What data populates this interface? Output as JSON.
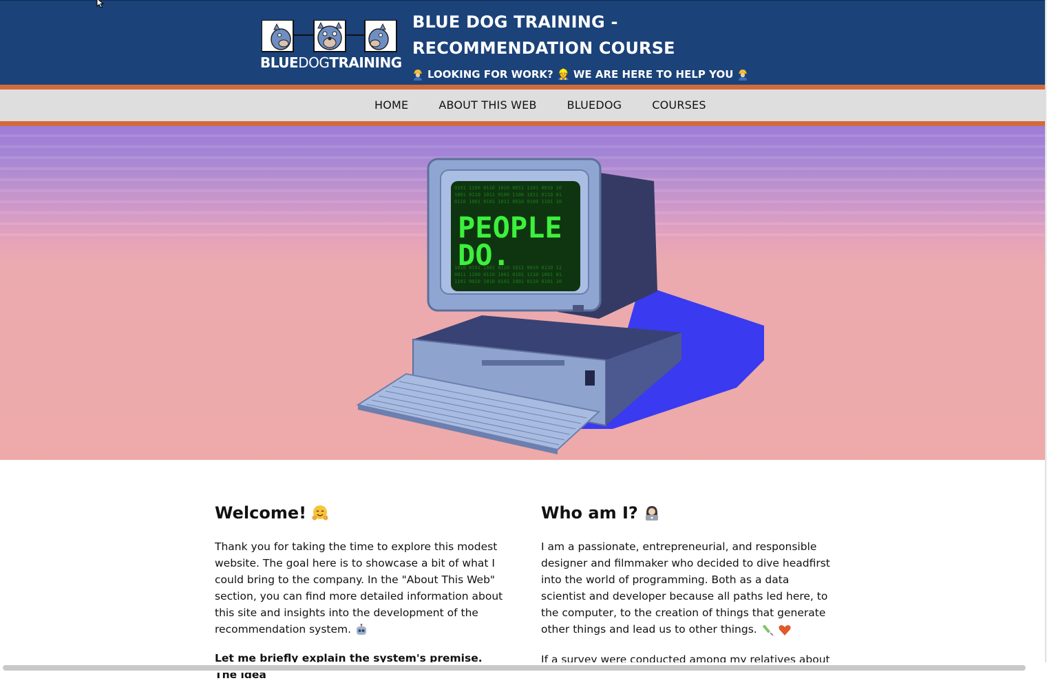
{
  "header": {
    "logo": {
      "text_bold_1": "BLUE",
      "text_thin": "DOG",
      "text_bold_2": "TRAINING",
      "icon": "bulldog-logo-icon"
    },
    "title": "BLUE DOG TRAINING - RECOMMENDATION COURSE",
    "tagline": "LOOKING FOR WORK? 👷 WE ARE HERE TO HELP YOU",
    "tagline_icon": "construction-worker-icon"
  },
  "nav": {
    "items": [
      {
        "label": "HOME"
      },
      {
        "label": "ABOUT THIS WEB"
      },
      {
        "label": "BLUEDOG"
      },
      {
        "label": "COURSES"
      }
    ]
  },
  "hero": {
    "screen_text_line1": "PEOPLE",
    "screen_text_line2": "DO.",
    "image": "retro-computer-illustration"
  },
  "welcome": {
    "heading": "Welcome!",
    "heading_icon": "hugging-face-icon",
    "paragraph": "Thank you for taking the time to explore this modest website. The goal here is to showcase a bit of what I could bring to the company. In the \"About This Web\" section, you can find more detailed information about this site and insights into the development of the recommendation system.",
    "paragraph_icon": "robot-icon",
    "bold_intro": "Let me briefly explain the system's premise. The idea"
  },
  "who": {
    "heading": "Who am I?",
    "heading_icon": "technologist-icon",
    "paragraph": "I am a passionate, entrepreneurial, and responsible designer and filmmaker who decided to dive headfirst into the world of programming. Both as a data scientist and developer because all paths led here, to the computer, to the creation of things that generate other things and lead us to other things.",
    "paragraph_icons": [
      "syringe-icon",
      "heart-icon"
    ],
    "next_paragraph": "If a survey were conducted among my relatives about"
  },
  "colors": {
    "header_bg": "#1b4279",
    "accent_orange": "#d26a3b",
    "nav_bg": "#dedede",
    "hero_top": "#9f7cd8",
    "hero_bottom": "#eeaaa9",
    "screen_green": "#3cf03c"
  }
}
